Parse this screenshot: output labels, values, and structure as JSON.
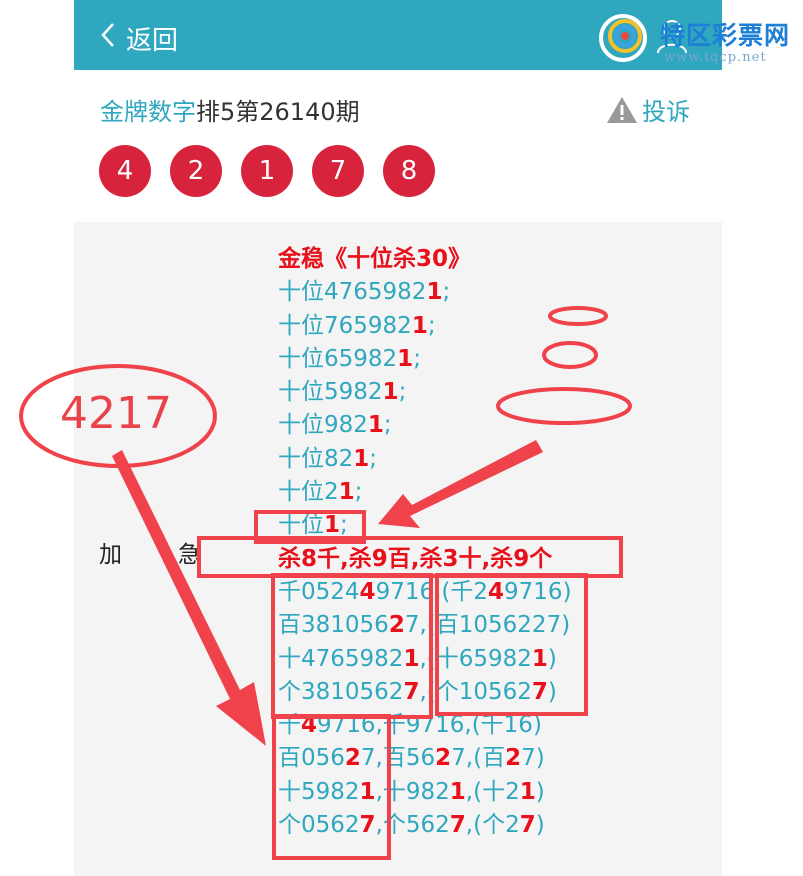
{
  "nav": {
    "back_label": "返回"
  },
  "watermark": {
    "name": "特区彩票网",
    "url": "www.tqcp.net"
  },
  "header": {
    "title_link": "金牌数字",
    "title_rest": "排5第26140期",
    "complain_label": "投诉"
  },
  "balls": [
    "4",
    "2",
    "1",
    "7",
    "8"
  ],
  "side_labels": [
    "加",
    "急"
  ],
  "annotation": {
    "number": "4217"
  },
  "content": {
    "heading": "金稳《十位杀30》",
    "lines": [
      {
        "pre": "十位4765982",
        "red": "1",
        "post": ";"
      },
      {
        "pre": "十位765982",
        "red": "1",
        "post": ";"
      },
      {
        "pre": "十位65982",
        "red": "1",
        "post": ";"
      },
      {
        "pre": "十位5982",
        "red": "1",
        "post": ";"
      },
      {
        "pre": "十位982",
        "red": "1",
        "post": ";"
      },
      {
        "pre": "十位82",
        "red": "1",
        "post": ";"
      },
      {
        "pre": "十位2",
        "red": "1",
        "post": ";"
      },
      {
        "pre": "十位",
        "red": "1",
        "post": ";"
      }
    ],
    "kill_line": "杀8千,杀9百,杀3十,杀9个",
    "group1": [
      [
        {
          "t": "千0524"
        },
        {
          "t": "4",
          "r": true
        },
        {
          "t": "9716,(千2"
        },
        {
          "t": "4",
          "r": true
        },
        {
          "t": "9716)"
        }
      ],
      [
        {
          "t": "百381056"
        },
        {
          "t": "2",
          "r": true
        },
        {
          "t": "7,(百10562"
        },
        {
          "t": "2",
          "r": false
        },
        {
          "t": "7)"
        }
      ],
      [
        {
          "t": "十4765982"
        },
        {
          "t": "1",
          "r": true
        },
        {
          "t": ",(十65982"
        },
        {
          "t": "1",
          "r": true
        },
        {
          "t": ")"
        }
      ],
      [
        {
          "t": "个3810562"
        },
        {
          "t": "7",
          "r": true
        },
        {
          "t": ",(个10562"
        },
        {
          "t": "7",
          "r": true
        },
        {
          "t": ")"
        }
      ]
    ],
    "group2": [
      [
        {
          "t": "千"
        },
        {
          "t": "4",
          "r": true
        },
        {
          "t": "9716,千9716,(千16)"
        }
      ],
      [
        {
          "t": "百056"
        },
        {
          "t": "2",
          "r": true
        },
        {
          "t": "7,百56"
        },
        {
          "t": "2",
          "r": true
        },
        {
          "t": "7,(百"
        },
        {
          "t": "2",
          "r": true
        },
        {
          "t": "7)"
        }
      ],
      [
        {
          "t": "十5982"
        },
        {
          "t": "1",
          "r": true
        },
        {
          "t": ",十982"
        },
        {
          "t": "1",
          "r": true
        },
        {
          "t": ",(十2"
        },
        {
          "t": "1",
          "r": true
        },
        {
          "t": ")"
        }
      ],
      [
        {
          "t": "个0562"
        },
        {
          "t": "7",
          "r": true
        },
        {
          "t": ",个562"
        },
        {
          "t": "7",
          "r": true
        },
        {
          "t": ",(个2"
        },
        {
          "t": "7",
          "r": true
        },
        {
          "t": ")"
        }
      ]
    ]
  },
  "colors": {
    "accent": "#2fa7bf",
    "ball": "#d8233c",
    "highlight": "#e8101a",
    "annotation": "#e8424a"
  }
}
